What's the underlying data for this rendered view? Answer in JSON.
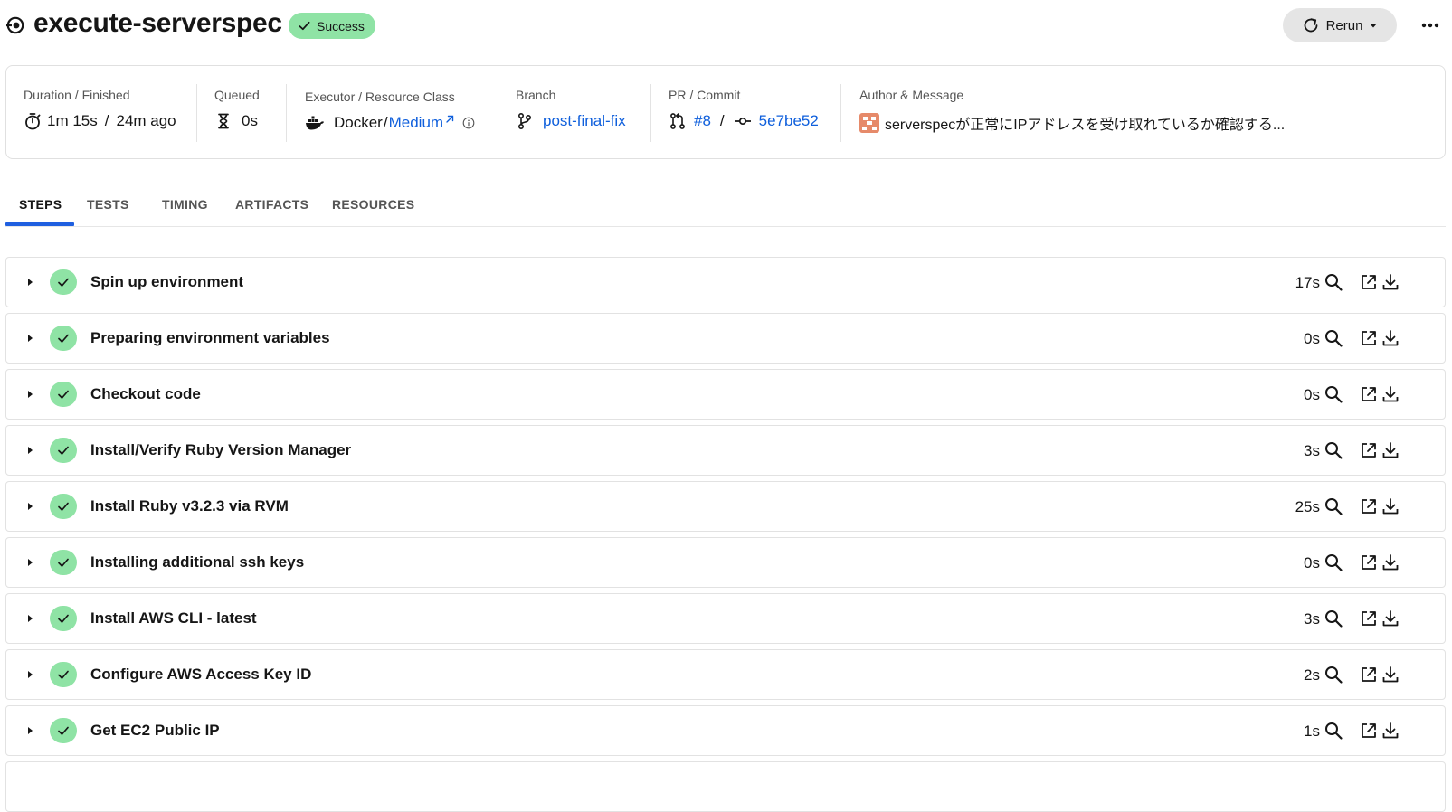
{
  "job": {
    "title": "execute-serverspec",
    "status": "Success",
    "rerun_label": "Rerun"
  },
  "summary": {
    "duration": {
      "label": "Duration / Finished",
      "duration": "1m 15s",
      "sep": "/",
      "finished": "24m ago"
    },
    "queued": {
      "label": "Queued",
      "value": "0s"
    },
    "executor": {
      "label": "Executor / Resource Class",
      "executor": "Docker",
      "sep": "/",
      "resource_class": "Medium"
    },
    "branch": {
      "label": "Branch",
      "value": "post-final-fix"
    },
    "pr_commit": {
      "label": "PR / Commit",
      "pr": "#8",
      "sep": "/",
      "commit": "5e7be52"
    },
    "author": {
      "label": "Author & Message",
      "message": "serverspecが正常にIPアドレスを受け取れているか確認する..."
    }
  },
  "tabs": [
    {
      "label": "STEPS",
      "active": true
    },
    {
      "label": "TESTS"
    },
    {
      "label": "TIMING"
    },
    {
      "label": "ARTIFACTS"
    },
    {
      "label": "RESOURCES"
    }
  ],
  "steps": [
    {
      "name": "Spin up environment",
      "duration": "17s"
    },
    {
      "name": "Preparing environment variables",
      "duration": "0s"
    },
    {
      "name": "Checkout code",
      "duration": "0s"
    },
    {
      "name": "Install/Verify Ruby Version Manager",
      "duration": "3s"
    },
    {
      "name": "Install Ruby v3.2.3 via RVM",
      "duration": "25s"
    },
    {
      "name": "Installing additional ssh keys",
      "duration": "0s"
    },
    {
      "name": "Install AWS CLI - latest",
      "duration": "3s"
    },
    {
      "name": "Configure AWS Access Key ID",
      "duration": "2s"
    },
    {
      "name": "Get EC2 Public IP",
      "duration": "1s"
    }
  ],
  "colors": {
    "success_green": "#8fe3a5",
    "link_blue": "#0f5fdc",
    "tab_underline": "#1f5fe0"
  },
  "icons": {
    "job": "job-status-icon",
    "badge": "checkmark-icon",
    "rerun": "rerun-icon",
    "more": "more-dots-icon",
    "duration": "stopwatch-icon",
    "queued": "hourglass-icon",
    "executor": "docker-icon",
    "branch": "branch-icon",
    "pr": "pull-request-icon",
    "commit": "commit-icon",
    "step_actions": [
      "search-icon",
      "open-external-icon",
      "download-icon"
    ]
  }
}
